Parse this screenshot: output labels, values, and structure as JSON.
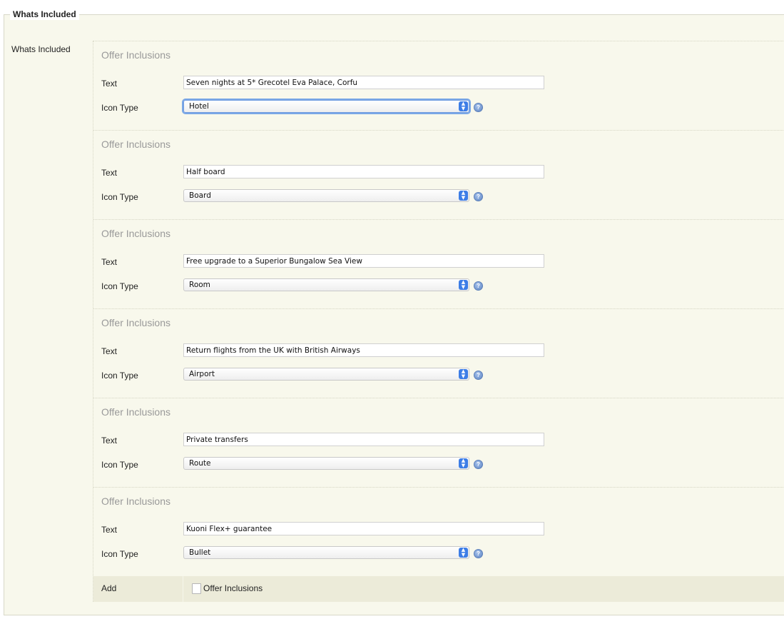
{
  "section": {
    "legend": "Whats Included",
    "side_label": "Whats Included"
  },
  "groups": [
    {
      "title": "Offer Inclusions",
      "text_label": "Text",
      "text_value": "Seven nights at 5* Grecotel Eva Palace, Corfu",
      "icon_label": "Icon Type",
      "icon_value": "Hotel"
    },
    {
      "title": "Offer Inclusions",
      "text_label": "Text",
      "text_value": "Half board",
      "icon_label": "Icon Type",
      "icon_value": "Board"
    },
    {
      "title": "Offer Inclusions",
      "text_label": "Text",
      "text_value": "Free upgrade to a Superior Bungalow Sea View",
      "icon_label": "Icon Type",
      "icon_value": "Room"
    },
    {
      "title": "Offer Inclusions",
      "text_label": "Text",
      "text_value": "Return flights from the UK with British Airways",
      "icon_label": "Icon Type",
      "icon_value": "Airport"
    },
    {
      "title": "Offer Inclusions",
      "text_label": "Text",
      "text_value": "Private transfers",
      "icon_label": "Icon Type",
      "icon_value": "Route"
    },
    {
      "title": "Offer Inclusions",
      "text_label": "Text",
      "text_value": "Kuoni Flex+ guarantee",
      "icon_label": "Icon Type",
      "icon_value": "Bullet"
    }
  ],
  "add_row": {
    "label": "Add",
    "checkbox_label": "Offer Inclusions",
    "checked": false
  },
  "icons": {
    "help": "help-icon",
    "select_arrows": "select-arrows-icon"
  },
  "colors": {
    "panel_bg": "#f8f8ec",
    "add_row_bg": "#ecebd9",
    "accent": "#3d7de6"
  }
}
